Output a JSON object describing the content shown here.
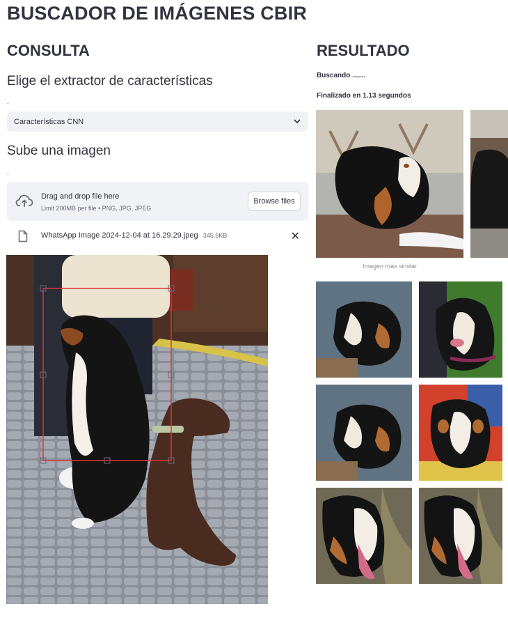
{
  "page": {
    "title": "BUSCADOR DE IMÁGENES CBIR"
  },
  "query": {
    "heading": "CONSULTA",
    "extractor_heading": "Elige el extractor de características",
    "extractor_label": ".",
    "extractor_selected": "Características CNN",
    "upload_heading": "Sube una imagen",
    "upload_label": ".",
    "dropzone_title": "Drag and drop file here",
    "dropzone_subtitle": "Limit 200MB per file • PNG, JPG, JPEG",
    "browse_label": "Browse files",
    "file_name": "WhatsApp Image 2024-12-04 at 16.29.29.jpeg",
    "file_size": "345.5KB",
    "remove_symbol": "✕"
  },
  "result": {
    "heading": "RESULTADO",
    "status_searching": "Buscando .......",
    "status_done": "Finalizado en 1.13 segundos",
    "top_caption": "Imagen más similar"
  },
  "colors": {
    "crop_box": "#e0323c",
    "dropzone_bg": "#f0f2f6",
    "text": "#31333f"
  },
  "icons": {
    "upload": "cloud-upload-icon",
    "file": "file-icon",
    "dropdown": "chevron-down-icon",
    "remove": "close-icon"
  }
}
